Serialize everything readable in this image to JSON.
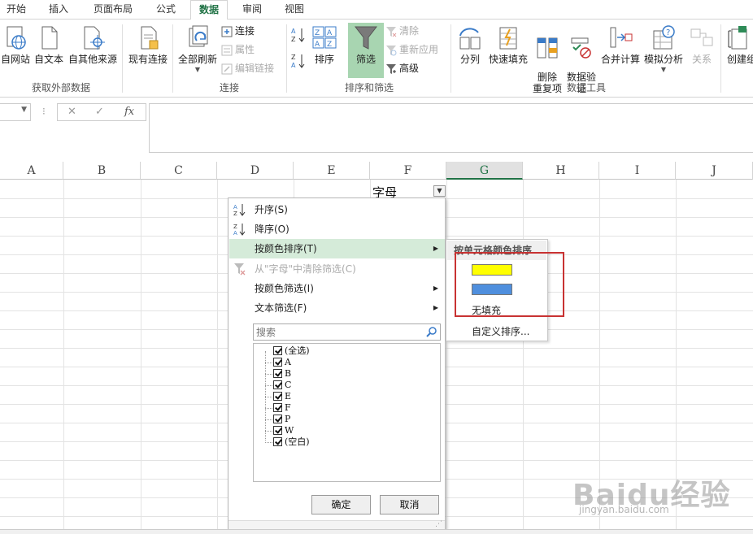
{
  "ribbon_tabs": [
    "开始",
    "插入",
    "页面布局",
    "公式",
    "数据",
    "审阅",
    "视图"
  ],
  "active_tab": "数据",
  "groups": {
    "external": {
      "label": "获取外部数据",
      "buttons": [
        "自网站",
        "自文本",
        "自其他来源",
        "现有连接"
      ]
    },
    "connections": {
      "label": "连接",
      "refresh_all": "全部刷新",
      "small": [
        "连接",
        "属性",
        "编辑链接"
      ]
    },
    "sort_filter": {
      "label": "排序和筛选",
      "sort": "排序",
      "filter": "筛选",
      "small": [
        "清除",
        "重新应用",
        "高级"
      ]
    },
    "data_tools": {
      "label": "数据工具",
      "buttons": [
        "分列",
        "快速填充",
        "删除\n重复项",
        "数据验\n证",
        "合并计算",
        "模拟分析",
        "关系"
      ]
    },
    "outline": {
      "buttons": [
        "创建组"
      ]
    }
  },
  "formula_bar": {
    "fx": "fx",
    "cancel": "✕",
    "enter": "✓",
    "value": ""
  },
  "columns": [
    "A",
    "B",
    "C",
    "D",
    "E",
    "F",
    "G",
    "H",
    "I",
    "J"
  ],
  "selected_column": "G",
  "header_cell": "字母",
  "filter_menu": {
    "sort_asc": "升序(S)",
    "sort_desc": "降序(O)",
    "sort_by_color": "按颜色排序(T)",
    "clear_filter": "从\"字母\"中清除筛选(C)",
    "filter_by_color": "按颜色筛选(I)",
    "text_filter": "文本筛选(F)",
    "search_placeholder": "搜索",
    "items": [
      "(全选)",
      "A",
      "B",
      "C",
      "E",
      "F",
      "P",
      "W",
      "(空白)"
    ],
    "ok": "确定",
    "cancel": "取消"
  },
  "color_submenu": {
    "title": "按单元格颜色排序",
    "colors": [
      "#ffff00",
      "#4f8fde"
    ],
    "no_fill": "无填充",
    "custom": "自定义排序..."
  },
  "watermark": {
    "brand": "Baidu经验",
    "url": "jingyan.baidu.com"
  }
}
